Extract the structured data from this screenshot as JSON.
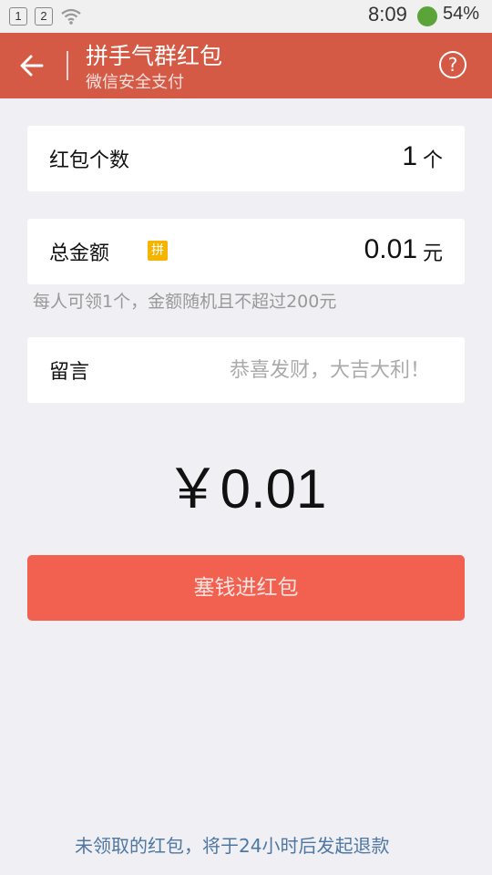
{
  "status_bar": {
    "sim1": "1",
    "sim2": "2",
    "time": "8:09",
    "battery": "54%"
  },
  "header": {
    "title": "拼手气群红包",
    "subtitle": "微信安全支付"
  },
  "count_card": {
    "label": "红包个数",
    "value": "1",
    "unit": "个"
  },
  "total_card": {
    "label": "总金额",
    "badge": "拼",
    "value": "0.01",
    "unit": "元"
  },
  "hint": "每人可领1个，金额随机且不超过200元",
  "message_card": {
    "label": "留言",
    "placeholder": "恭喜发财，大吉大利！"
  },
  "amount_display": "￥0.01",
  "submit_label": "塞钱进红包",
  "footer_note": "未领取的红包，将于24小时后发起退款"
}
